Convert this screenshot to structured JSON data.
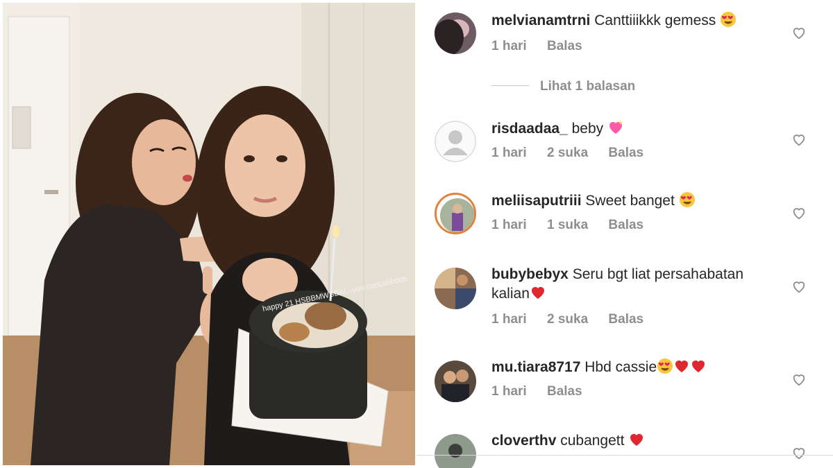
{
  "comments": [
    {
      "username": "melvianamtrni",
      "text": "Canttiiikkk gemess",
      "emoji": [
        "heart-eyes"
      ],
      "time": "1 hari",
      "likes": "",
      "reply": "Balas"
    },
    {
      "username": "risdaadaa_",
      "text": "beby",
      "emoji": [
        "sparkling-heart"
      ],
      "time": "1 hari",
      "likes": "2 suka",
      "reply": "Balas"
    },
    {
      "username": "meliisaputriii",
      "text": "Sweet banget",
      "emoji": [
        "heart-eyes"
      ],
      "time": "1 hari",
      "likes": "1 suka",
      "reply": "Balas"
    },
    {
      "username": "bubybebyx",
      "text": "Seru bgt liat persahabatan kalian",
      "emoji": [
        "red-heart"
      ],
      "time": "1 hari",
      "likes": "2 suka",
      "reply": "Balas"
    },
    {
      "username": "mu.tiara8717",
      "text": "Hbd cassie",
      "emoji": [
        "heart-eyes",
        "red-heart",
        "red-heart"
      ],
      "time": "1 hari",
      "likes": "",
      "reply": "Balas"
    },
    {
      "username": "cloverthv",
      "text": "cubangett",
      "emoji": [
        "red-heart"
      ],
      "time": "",
      "likes": "",
      "reply": ""
    }
  ],
  "view_replies": "Lihat 1 balasan",
  "photo": {
    "cake_text": "happy 21 HSBBMWSBAL -yuu cupcabbdds",
    "colors": {
      "cake": "#2a2b28",
      "wall": "#efe9e0",
      "jacket": "#2b2523",
      "hair": "#3a2418"
    }
  }
}
